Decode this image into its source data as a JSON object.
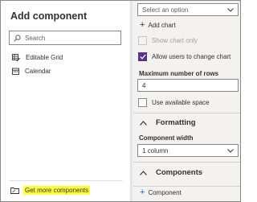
{
  "left_panel": {
    "title": "Add component",
    "search": {
      "placeholder": "Search",
      "icon": "search-icon"
    },
    "items": [
      {
        "label": "Editable Grid",
        "icon": "editable-grid-icon"
      },
      {
        "label": "Calendar",
        "icon": "calendar-icon"
      }
    ],
    "get_more": {
      "label": "Get more components",
      "icon": "folder-icon",
      "highlight_color": "#ffff3a"
    }
  },
  "properties": {
    "option_select": {
      "placeholder": "Select an option"
    },
    "add_chart_label": "Add chart",
    "show_chart_only": {
      "label": "Show chart only",
      "checked": false,
      "disabled": true
    },
    "allow_change_chart": {
      "label": "Allow users to change chart",
      "checked": true
    },
    "max_rows": {
      "label": "Maximum number of rows",
      "value": "4"
    },
    "use_available_space": {
      "label": "Use available space",
      "checked": false
    },
    "formatting": {
      "header": "Formatting",
      "width_label": "Component width",
      "width_value": "1 column"
    },
    "components": {
      "header": "Components",
      "add_label": "Component"
    },
    "accent_color": "#5c2e91"
  }
}
